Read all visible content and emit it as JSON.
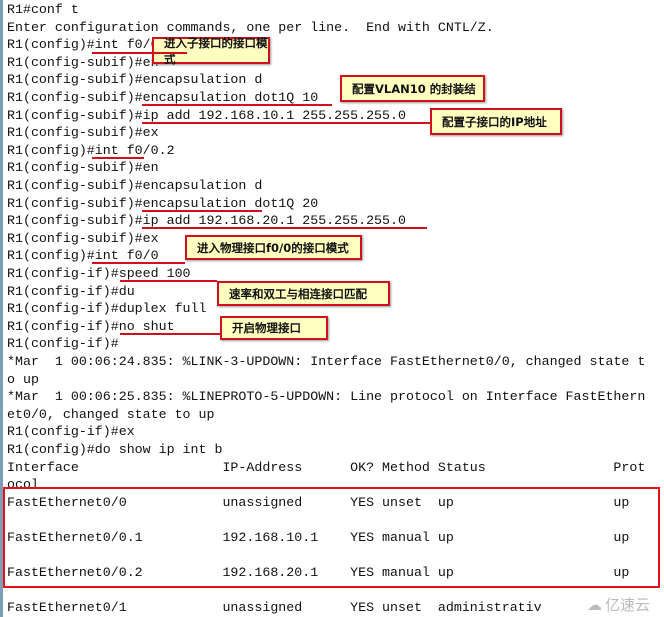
{
  "terminal": {
    "lines": [
      "R1#conf t",
      "Enter configuration commands, one per line.  End with CNTL/Z.",
      "R1(config)#int f0/0.1",
      "R1(config-subif)#en",
      "R1(config-subif)#encapsulation d",
      "R1(config-subif)#encapsulation dot1Q 10",
      "R1(config-subif)#ip add 192.168.10.1 255.255.255.0",
      "R1(config-subif)#ex",
      "R1(config)#int f0/0.2",
      "R1(config-subif)#en",
      "R1(config-subif)#encapsulation d",
      "R1(config-subif)#encapsulation dot1Q 20",
      "R1(config-subif)#ip add 192.168.20.1 255.255.255.0",
      "R1(config-subif)#ex",
      "R1(config)#int f0/0",
      "R1(config-if)#speed 100",
      "R1(config-if)#du",
      "R1(config-if)#duplex full",
      "R1(config-if)#no shut",
      "R1(config-if)#",
      "*Mar  1 00:06:24.835: %LINK-3-UPDOWN: Interface FastEthernet0/0, changed state t",
      "o up",
      "*Mar  1 00:06:25.835: %LINEPROTO-5-UPDOWN: Line protocol on Interface FastEthern",
      "et0/0, changed state to up",
      "R1(config-if)#ex",
      "R1(config)#do show ip int b",
      "Interface                  IP-Address      OK? Method Status                Prot",
      "ocol",
      "FastEthernet0/0            unassigned      YES unset  up                    up",
      "",
      "FastEthernet0/0.1          192.168.10.1    YES manual up                    up",
      "",
      "FastEthernet0/0.2          192.168.20.1    YES manual up                    up",
      "",
      "FastEthernet0/1            unassigned      YES unset  administrativ"
    ]
  },
  "annotations": [
    "进入子接口的接口模式",
    "配置VLAN10 的封装结",
    "配置子接口的IP地址",
    "进入物理接口f0/0的接口模式",
    "速率和双工与相连接口匹配",
    "开启物理接口"
  ],
  "watermark": "亿速云",
  "colors": {
    "highlight": "#d0101c",
    "note_bg": "#ffffc0"
  }
}
